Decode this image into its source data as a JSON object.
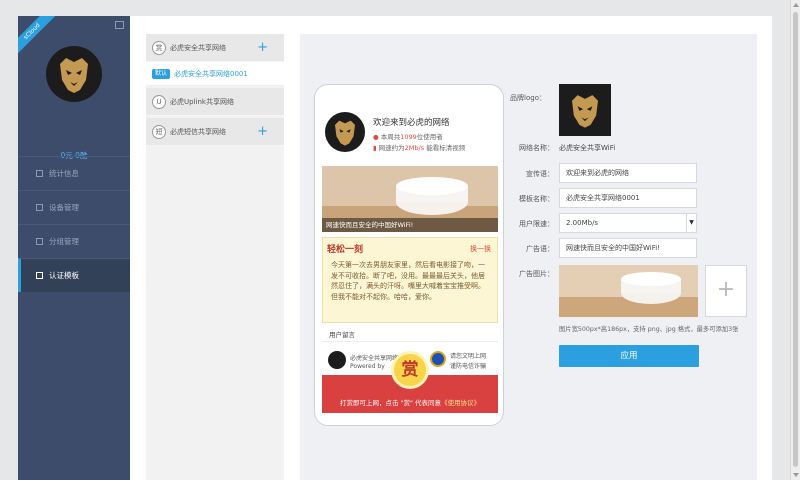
{
  "sidebar": {
    "ribbon": "sCloud",
    "stats": "0元  0酷",
    "nav": [
      {
        "label": "统计信息",
        "icon": "chart-icon"
      },
      {
        "label": "设备管理",
        "icon": "device-icon"
      },
      {
        "label": "分组管理",
        "icon": "group-icon"
      },
      {
        "label": "认证模板",
        "icon": "template-icon"
      }
    ]
  },
  "templates": {
    "items": [
      {
        "badge": "赏",
        "label": "必虎安全共享网络"
      },
      {
        "tag": "默认",
        "label": "必虎安全共享网络0001"
      },
      {
        "badge": "U",
        "label": "必虎Uplink共享网络"
      },
      {
        "badge": "短",
        "label": "必虎短信共享网络"
      }
    ],
    "add_symbol": "+"
  },
  "preview": {
    "title": "欢迎来到必虎的网络",
    "users_prefix": "本周共",
    "users_count": "1099",
    "users_suffix": "位使用者",
    "speed_prefix": "网速约为",
    "speed_value": "2Mb/s",
    "speed_suffix": "能看标清视频",
    "banner_caption": "网速快而且安全的中国好WiFi!",
    "joke_title": "轻松一刻",
    "joke_switch": "换一换",
    "joke_text": "今天第一次去男朋友家里，然后看电影接了吻，一发不可收拾。断了吧，没用。最最最后关头，他居然忍住了，满头的汗呀。嘴里大喊着宝宝推受啊。但我不能对不起你。哈哈，爱你。",
    "message_label": "用户留言",
    "footer_name": "必虎安全共享网络",
    "footer_powered": "Powered by",
    "footer_police1": "请您文明上网",
    "footer_police2": "谨防电信诈骗",
    "reward_char": "赏",
    "red_text_pre": "打赏即可上网，点击 \"赏\" 代表同意",
    "red_text_link": "《使用协议》"
  },
  "form": {
    "brand_logo_label": "品牌logo：",
    "network_name_label": "网络名称：",
    "network_name_value": "必虎安全共享WiFi",
    "slogan_label": "宣传语：",
    "slogan_value": "欢迎来到必虎的网络",
    "template_name_label": "模板名称：",
    "template_name_value": "必虎安全共享网络0001",
    "speed_limit_label": "用户限速：",
    "speed_limit_value": "2.00Mb/s",
    "ad_text_label": "广告语：",
    "ad_text_value": "网速快而且安全的中国好WiFi!",
    "ad_image_label": "广告图片：",
    "add_symbol": "+",
    "hint": "图片宽500px*高186px，支持 png、jpg 格式，最多可添加3张",
    "apply": "应用"
  },
  "colors": {
    "accent": "#2b9fe0",
    "sidebar": "#3d4c6a",
    "red": "#d94040"
  }
}
